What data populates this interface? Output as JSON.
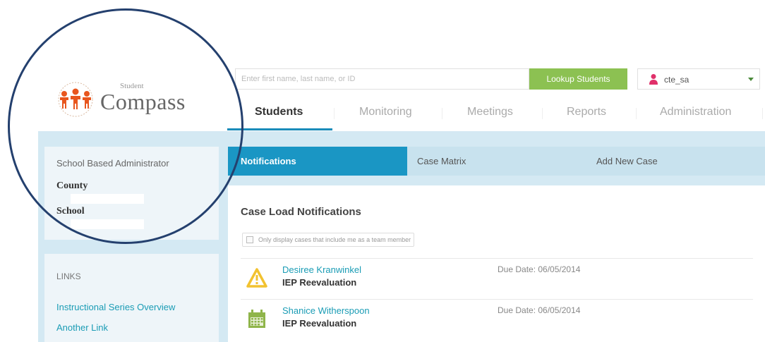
{
  "logo": {
    "small_text": "Student",
    "big_text": "Compass"
  },
  "search": {
    "placeholder": "Enter first name, last name, or ID",
    "lookup_label": "Lookup Students"
  },
  "user": {
    "name": "cte_sa",
    "icon": "user-icon"
  },
  "nav": {
    "items": [
      {
        "label": "Students",
        "active": true
      },
      {
        "label": "Monitoring",
        "active": false
      },
      {
        "label": "Meetings",
        "active": false
      },
      {
        "label": "Reports",
        "active": false
      },
      {
        "label": "Administration",
        "active": false
      }
    ]
  },
  "sidebar": {
    "role": "School Based Administrator",
    "county_label": "County",
    "school_label": "School",
    "links_heading": "LINKS",
    "links": [
      {
        "label": "Instructional Series Overview"
      },
      {
        "label": "Another Link"
      }
    ]
  },
  "subtabs": [
    {
      "label": "Notifications",
      "active": true
    },
    {
      "label": "Case Matrix",
      "active": false
    },
    {
      "label": "Add New Case",
      "active": false
    }
  ],
  "notifications": {
    "title": "Case Load Notifications",
    "filter_label": "Only display cases that include me as a team member",
    "rows": [
      {
        "name": "Desiree Kranwinkel",
        "type": "IEP Reevaluation",
        "due": "Due Date: 06/05/2014",
        "icon": "warning-icon"
      },
      {
        "name": "Shanice Witherspoon",
        "type": "IEP Reevaluation",
        "due": "Due Date: 06/05/2014",
        "icon": "calendar-icon"
      }
    ]
  },
  "colors": {
    "accent_blue": "#1a96c4",
    "lookup_green": "#8cc152",
    "panel_blue": "#d4e9f3",
    "annotation_circle": "#24406e",
    "warning_yellow": "#f2c230",
    "calendar_green": "#8fb54a"
  }
}
